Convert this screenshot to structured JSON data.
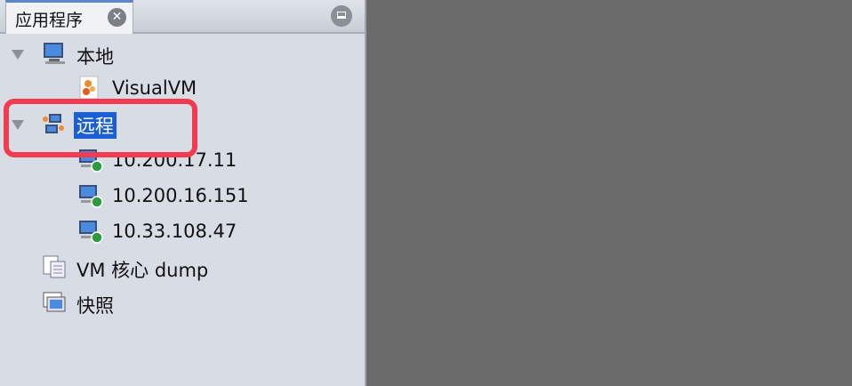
{
  "tab": {
    "title": "应用程序",
    "close_icon": "close-icon"
  },
  "tree": {
    "local": {
      "label": "本地",
      "children": [
        {
          "label": "VisualVM"
        }
      ]
    },
    "remote": {
      "label": "远程",
      "children": [
        {
          "label": "10.200.17.11"
        },
        {
          "label": "10.200.16.151"
        },
        {
          "label": "10.33.108.47"
        }
      ]
    },
    "core_dump": {
      "label": "VM 核心 dump"
    },
    "snapshots": {
      "label": "快照"
    }
  },
  "colors": {
    "selection": "#1a5fd4",
    "highlight": "#f23a52"
  }
}
